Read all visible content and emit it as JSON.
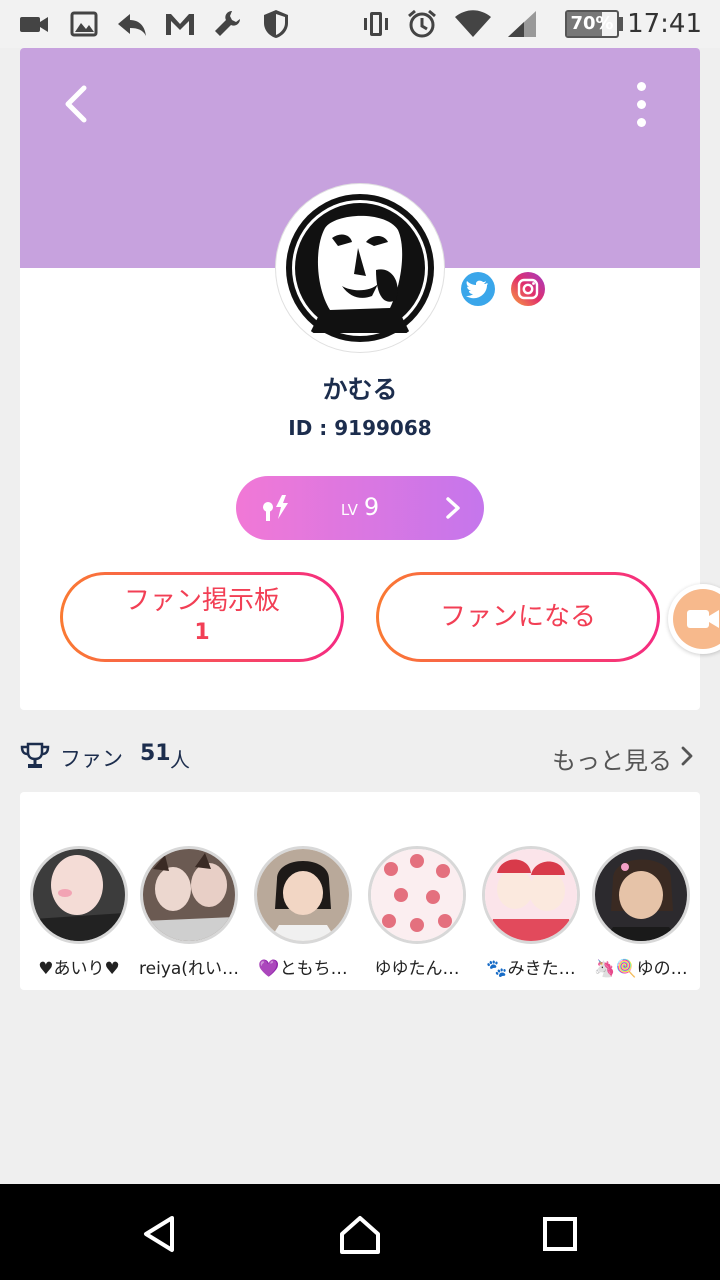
{
  "status_bar": {
    "time": "17:41",
    "battery_percent": "70%",
    "battery_level": 0.7,
    "icons": [
      "video-camera-icon",
      "image-icon",
      "reply-icon",
      "gmail-icon",
      "wrench-icon",
      "shield-icon",
      "vibrate-icon",
      "alarm-icon",
      "wifi-icon",
      "signal-icon",
      "battery-icon"
    ]
  },
  "header": {
    "color": "#c7a2de",
    "back_icon": "chevron-left-icon",
    "menu_icon": "more-vertical-icon"
  },
  "profile": {
    "name": "かむる",
    "id_label": "ID : 9199068",
    "social": [
      "twitter-icon",
      "instagram-icon"
    ]
  },
  "level": {
    "lv_label": "LV",
    "value": "9"
  },
  "actions": {
    "board_label": "ファン掲示板",
    "board_count": "1",
    "become_fan_label": "ファンになる"
  },
  "fans": {
    "label": "ファン",
    "count": "51",
    "unit": "人",
    "see_more": "もっと見る",
    "items": [
      {
        "name": "♥あいり♥"
      },
      {
        "name": "reiya(れい…"
      },
      {
        "name": "💜ともち…"
      },
      {
        "name": "ゆゆたん…"
      },
      {
        "name": "🐾みきた…"
      },
      {
        "name": "🦄🍭ゆの…"
      }
    ]
  },
  "colors": {
    "accent_orange": "#fa7a32",
    "accent_pink": "#f52a82",
    "level_gradient_start": "#f178d6",
    "level_gradient_end": "#c576ec"
  }
}
